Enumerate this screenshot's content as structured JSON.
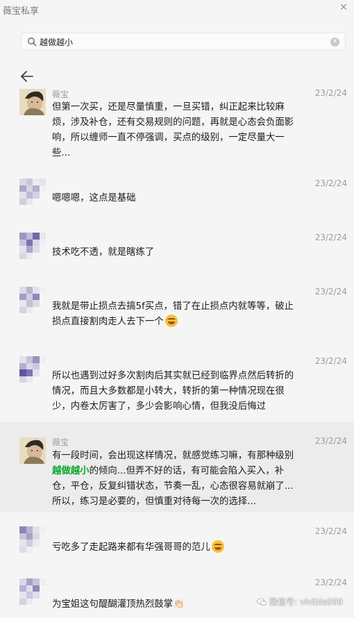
{
  "window": {
    "title": "薇宝私享"
  },
  "search": {
    "value": "越做越小",
    "placeholder": ""
  },
  "messages": [
    {
      "sender": "薇宝",
      "date": "23/2/24",
      "avatar": "painting-avatar",
      "text": "但第一次买，还是尽量慎重，一旦买错，纠正起来比较麻烦，涉及补仓，还有交易规则的问题，再就是心态会负面影响，所以缠师一直不停强调，买点的级别，一定尽量大一些..."
    },
    {
      "sender": "",
      "date": "23/2/24",
      "avatar": "mosaic-avatar",
      "text": "嗯嗯嗯，这点是基础"
    },
    {
      "sender": "",
      "date": "23/2/24",
      "avatar": "mosaic-avatar",
      "text": "技术吃不透，就是瞎练了"
    },
    {
      "sender": "",
      "date": "23/2/24",
      "avatar": "mosaic-avatar",
      "text": "我就是带止损点去搞5f买点，错了在止损点内就等等，破止损点直接割肉走人去下一个",
      "emoji": "crying-laughing-emoji"
    },
    {
      "sender": "",
      "date": "23/2/24",
      "avatar": "mosaic-avatar",
      "text": "所以也遇到过好多次割肉后其实就已经到临界点然后转折的情况，而且大多数都是小转大，转折的第一种情况现在很少，内卷太厉害了，多少会影响心情，但我没后悔过"
    },
    {
      "sender": "薇宝",
      "date": "23/2/24",
      "avatar": "painting-avatar",
      "text_before": "有一段时间，会出现这样情况，就感觉练习嘛，有那种级别",
      "text_highlight": "越做越小",
      "text_after": "的倾向...但弄不好的话，有可能会陷入买入，补仓，平仓，反复纠错状态，节奏一乱，心态很容易就崩了...所以，练习是必要的，但慎重对待每一次的选择..."
    },
    {
      "sender": "",
      "date": "23/2/24",
      "avatar": "mosaic-avatar",
      "text": "亏吃多了走起路来都有华强哥哥的范儿",
      "emoji": "crying-laughing-emoji"
    },
    {
      "sender": "",
      "date": "23/2/24",
      "avatar": "mosaic-avatar",
      "text": "为宝姐这句醍醐灌顶热烈鼓掌👏🏻"
    }
  ],
  "watermark": {
    "text": "微信号: vivible999"
  },
  "colors": {
    "highlight_green": "#07a52a",
    "selected_row": "#ececec",
    "background": "#f5f5f5"
  }
}
